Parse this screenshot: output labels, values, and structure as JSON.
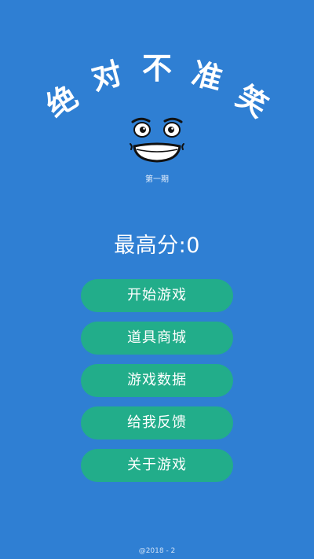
{
  "title_chars": [
    "绝",
    "对",
    "不",
    "准",
    "笑"
  ],
  "issue_label": "第一期",
  "score_text": "最高分:0",
  "menu": [
    {
      "label": "开始游戏"
    },
    {
      "label": "道具商城"
    },
    {
      "label": "游戏数据"
    },
    {
      "label": "给我反馈"
    },
    {
      "label": "关于游戏"
    }
  ],
  "footer_text": "@2018 - 2",
  "colors": {
    "background": "#2f7fd3",
    "button": "#22ad8a",
    "text": "#ffffff"
  },
  "icons": {
    "mascot": "grinning-face-icon"
  }
}
